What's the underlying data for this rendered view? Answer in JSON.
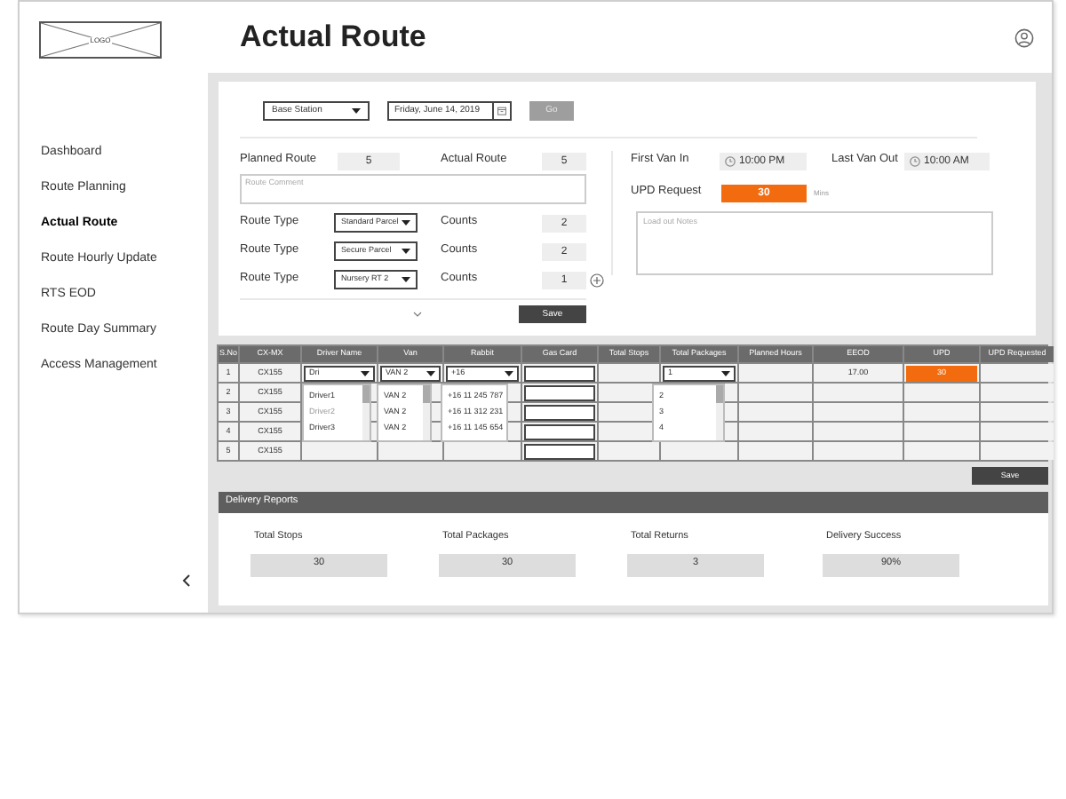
{
  "logo": "LOGO",
  "sidebar": {
    "items": [
      {
        "label": "Dashboard",
        "selected": false
      },
      {
        "label": "Route Planning",
        "selected": false
      },
      {
        "label": "Actual Route",
        "selected": true
      },
      {
        "label": "Route Hourly Update",
        "selected": false
      },
      {
        "label": "RTS EOD",
        "selected": false
      },
      {
        "label": "Route Day Summary",
        "selected": false
      },
      {
        "label": "Access Management",
        "selected": false
      }
    ]
  },
  "page_title": "Actual Route",
  "filters": {
    "station": "Base Station",
    "date": "Friday, June 14, 2019",
    "go": {
      "label": "Go",
      "disabled": true
    }
  },
  "planned_route": {
    "label": "Planned Route",
    "value": "5"
  },
  "actual_route": {
    "label": "Actual Route",
    "value": "5"
  },
  "route_comment": {
    "placeholder": "Route Comment"
  },
  "route_types": [
    {
      "label": "Route Type",
      "value": "Standard Parcel",
      "counts_label": "Counts",
      "count": "2"
    },
    {
      "label": "Route Type",
      "value": "Secure Parcel",
      "counts_label": "Counts",
      "count": "2"
    },
    {
      "label": "Route Type",
      "value": "Nursery RT 2",
      "counts_label": "Counts",
      "count": "1"
    }
  ],
  "route_save": "Save",
  "first_van_in": {
    "label": "First Van In",
    "value": "10:00 PM"
  },
  "last_van_out": {
    "label": "Last Van Out",
    "value": "10:00 AM"
  },
  "upd_request": {
    "label": "UPD Request",
    "value": "30",
    "unit": "Mins"
  },
  "load_out_notes": {
    "placeholder": "Load out Notes"
  },
  "table": {
    "columns": [
      "S.No",
      "CX-MX",
      "Driver Name",
      "Van",
      "Rabbit",
      "Gas Card",
      "Total Stops",
      "Total Packages",
      "Planned Hours",
      "EEOD",
      "UPD",
      "UPD Requested"
    ],
    "rows": [
      {
        "sno": "1",
        "cx_mx": "CX155",
        "driver_name": "Dri",
        "van": "VAN 2",
        "rabbit": "+16",
        "total_packages": "1",
        "eeod": "17.00",
        "upd": "30",
        "upd_flagged": true
      },
      {
        "sno": "2",
        "cx_mx": "CX155",
        "upd_flagged": false
      },
      {
        "sno": "3",
        "cx_mx": "CX155",
        "upd_flagged": false
      },
      {
        "sno": "4",
        "cx_mx": "CX155",
        "upd_flagged": false
      },
      {
        "sno": "5",
        "cx_mx": "CX155",
        "upd_flagged": false
      }
    ],
    "driver_options": [
      {
        "label": "Driver1",
        "disabled": false
      },
      {
        "label": "Driver2",
        "disabled": true
      },
      {
        "label": "Driver3",
        "disabled": false
      }
    ],
    "van_options": [
      {
        "label": "VAN 2",
        "disabled": false
      },
      {
        "label": "VAN 2",
        "disabled": false
      },
      {
        "label": "VAN 2",
        "disabled": false
      }
    ],
    "rabbit_options": [
      {
        "label": "+16 11 245 787",
        "disabled": false
      },
      {
        "label": "+16 11 312 231",
        "disabled": false
      },
      {
        "label": "+16 11 145 654",
        "disabled": false
      }
    ],
    "package_options": [
      {
        "label": "2",
        "disabled": false
      },
      {
        "label": "3",
        "disabled": false
      },
      {
        "label": "4",
        "disabled": false
      }
    ]
  },
  "table_save": "Save",
  "delivery_reports": {
    "title": "Delivery Reports",
    "stats": [
      {
        "label": "Total Stops",
        "value": "30"
      },
      {
        "label": "Total Packages",
        "value": "30"
      },
      {
        "label": "Total Returns",
        "value": "3"
      },
      {
        "label": "Delivery Success",
        "value": "90%"
      }
    ]
  }
}
